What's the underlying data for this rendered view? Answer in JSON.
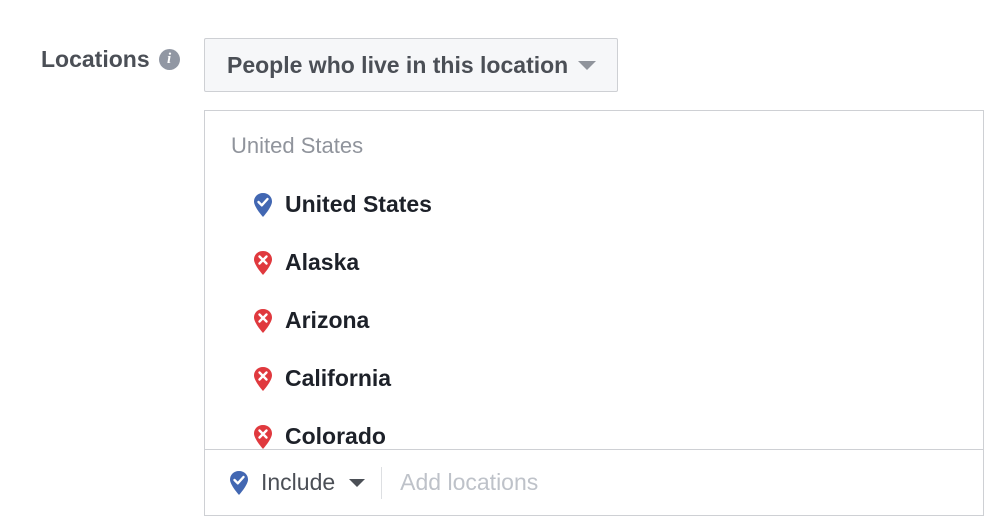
{
  "section": {
    "label": "Locations",
    "info_icon": "info-icon"
  },
  "audience_dropdown": {
    "value": "People who live in this location"
  },
  "locations": {
    "group_title": "United States",
    "items": [
      {
        "name": "United States",
        "mode": "include",
        "icon": "location-pin-check-icon",
        "color": "#4267b2"
      },
      {
        "name": "Alaska",
        "mode": "exclude",
        "icon": "location-pin-x-icon",
        "color": "#e0393e"
      },
      {
        "name": "Arizona",
        "mode": "exclude",
        "icon": "location-pin-x-icon",
        "color": "#e0393e"
      },
      {
        "name": "California",
        "mode": "exclude",
        "icon": "location-pin-x-icon",
        "color": "#e0393e"
      },
      {
        "name": "Colorado",
        "mode": "exclude",
        "icon": "location-pin-x-icon",
        "color": "#e0393e"
      }
    ]
  },
  "footer": {
    "include_label": "Include",
    "add_placeholder": "Add locations"
  }
}
